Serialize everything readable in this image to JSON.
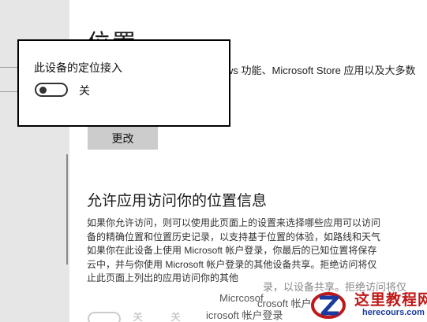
{
  "page": {
    "title": "位置",
    "intro_fragment": "ws 功能、Microsoft Store 应用以及大多数",
    "change_button": "更改"
  },
  "popup": {
    "title": "此设备的定位接入",
    "toggle_state": "关"
  },
  "section": {
    "heading": "允许应用访问你的位置信息",
    "paragraph_lines": [
      "如果你允许访问，则可以使用此页面上的设置来选择哪些应用可以访问",
      "备的精确位置和位置历史记录，以支持基于位置的体验，如路线和天气",
      "如果你在此设备上使用 Microsoft 帐户登录，你最后的已知位置将保存",
      "云中，并与你使用 Microsoft 帐户登录的其他设备共享。拒绝访问将仅",
      "止此页面上列出的应用访问你的其他"
    ],
    "overlay_fragments": [
      "录，以设备共享。拒绝访问将仅",
      "Micrcosof",
      "crosoft 帐户",
      "icrosoft 帐户登录"
    ],
    "bottom_toggle_labels": [
      "关",
      "关"
    ]
  },
  "watermark": {
    "site_name": "这里教程网",
    "url": "herecours.com"
  },
  "colors": {
    "sidebar_bg": "#e6e6e6",
    "button_bg": "#cccccc",
    "watermark_red": "#c01818",
    "watermark_blue": "#1a3aa0"
  }
}
